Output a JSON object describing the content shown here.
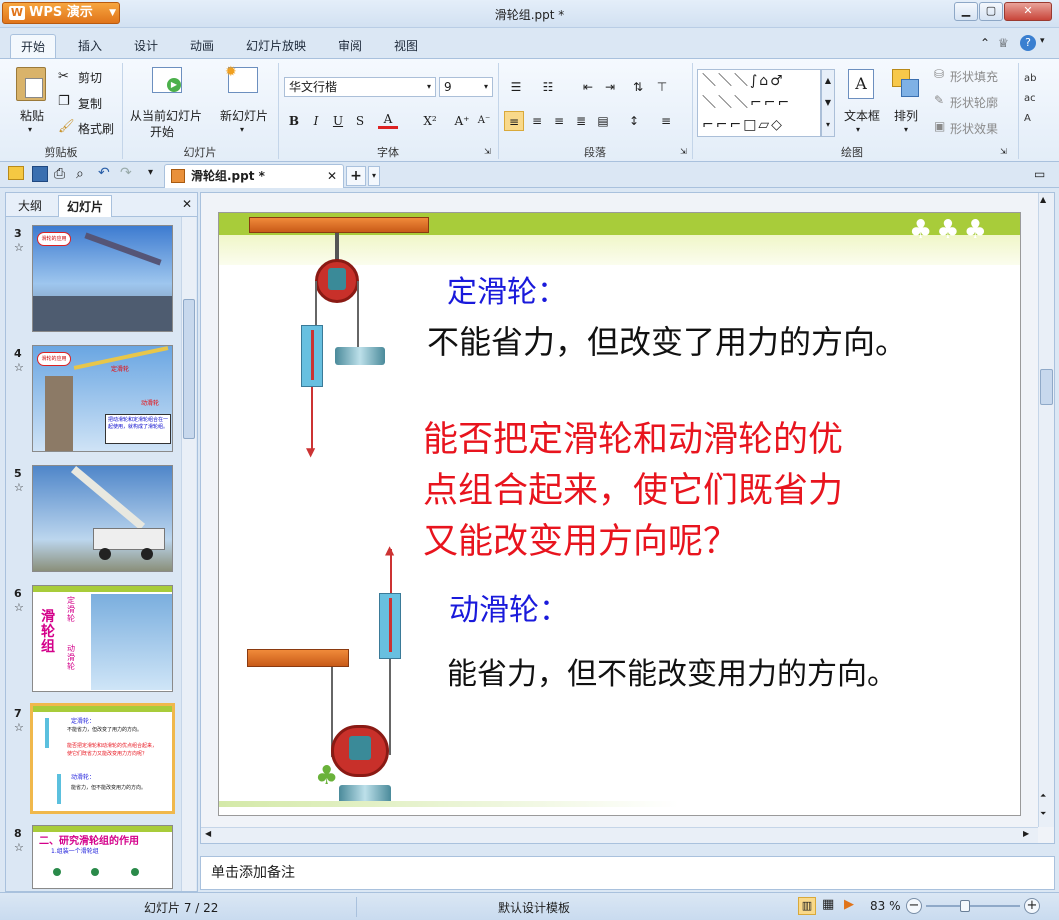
{
  "app": {
    "name": "WPS 演示",
    "window_title": "滑轮组.ppt *"
  },
  "ribbon_tabs": [
    "开始",
    "插入",
    "设计",
    "动画",
    "幻灯片放映",
    "审阅",
    "视图"
  ],
  "ribbon": {
    "clipboard": {
      "paste": "粘贴",
      "cut": "剪切",
      "copy": "复制",
      "format_painter": "格式刷",
      "group": "剪贴板"
    },
    "slides": {
      "from_current_line1": "从当前幻灯片",
      "from_current_line2": "开始",
      "new_slide": "新幻灯片",
      "group": "幻灯片"
    },
    "font": {
      "name": "华文行楷",
      "size": "9",
      "bold": "B",
      "italic": "I",
      "underline": "U",
      "shadow": "S",
      "color": "A",
      "superscript": "X²",
      "grow": "A⁺",
      "shrink": "A⁻",
      "group": "字体"
    },
    "paragraph": {
      "group": "段落"
    },
    "drawing": {
      "textbox": "文本框",
      "arrange": "排列",
      "shape_fill": "形状填充",
      "shape_outline": "形状轮廓",
      "shape_effect": "形状效果",
      "group": "绘图"
    }
  },
  "document_tab": {
    "name": "滑轮组.ppt *"
  },
  "left_panel": {
    "tabs": [
      "大纲",
      "幻灯片"
    ],
    "thumbs": [
      {
        "num": "3",
        "label": "滑轮的应用"
      },
      {
        "num": "4",
        "label": "滑轮的应用",
        "text1": "定滑轮",
        "text2": "动滑轮",
        "text3": "把动滑轮和定滑轮组合在一起使用，就构成了滑轮组。"
      },
      {
        "num": "5"
      },
      {
        "num": "6",
        "text1": "滑轮组",
        "text2": "定滑轮",
        "text3": "动滑轮"
      },
      {
        "num": "7",
        "text1": "定滑轮：",
        "text2": "不能省力，但改变了用力的方向。",
        "text3": "能否把定滑轮和动滑轮的优点组合起来，使它们既省力又能改变用力方向呢？",
        "text4": "动滑轮：",
        "text5": "能省力，但不能改变用力的方向。"
      },
      {
        "num": "8",
        "text1": "二、研究滑轮组的作用",
        "text2": "1.组装一个滑轮组"
      }
    ]
  },
  "slide": {
    "fixed_title": "定滑轮：",
    "fixed_desc": "不能省力，但改变了用力的方向。",
    "question_line1": "能否把定滑轮和动滑轮的优",
    "question_line2": "点组合起来，使它们既省力",
    "question_line3": "又能改变用方向呢？",
    "movable_title": "动滑轮：",
    "movable_desc": "能省力，但不能改变用力的方向。"
  },
  "notes_placeholder": "单击添加备注",
  "status": {
    "slide_pos": "幻灯片 7 / 22",
    "template": "默认设计模板",
    "zoom": "83 %",
    "zoom_level": 0.83
  },
  "colors": {
    "accent_orange": "#e0741a",
    "slide_blue": "#1a1adb",
    "slide_red": "#e8141e",
    "banner_green": "#a8cc3a"
  }
}
